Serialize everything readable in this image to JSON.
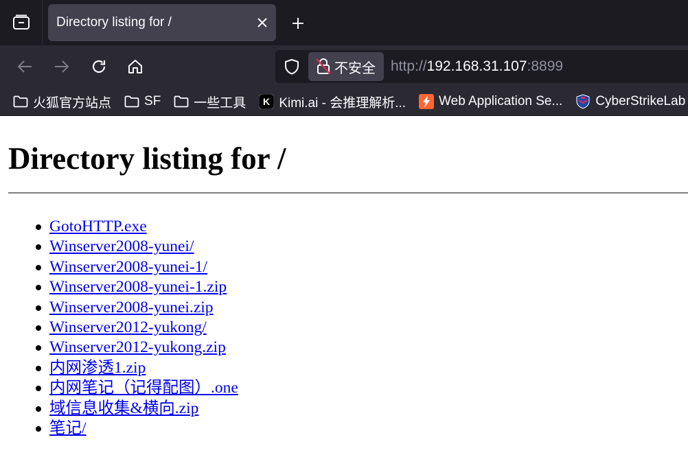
{
  "browser": {
    "tab": {
      "title": "Directory listing for /"
    },
    "urlbar": {
      "security_label": "不安全",
      "url_scheme": "http://",
      "url_host": "192.168.31.107",
      "url_port": ":8899"
    },
    "icons": {
      "tab_overview": "tab-overview-icon",
      "close": "close-icon",
      "new_tab": "plus-icon",
      "back": "arrow-left-icon",
      "forward": "arrow-right-icon",
      "reload": "reload-icon",
      "home": "home-icon",
      "shield": "shield-icon",
      "insecure_lock": "insecure-lock-icon"
    },
    "bookmarks": [
      {
        "label": "火狐官方站点",
        "icon": "folder-icon"
      },
      {
        "label": "SF",
        "icon": "folder-icon"
      },
      {
        "label": "一些工具",
        "icon": "folder-icon"
      },
      {
        "label": "Kimi.ai - 会推理解析...",
        "icon": "kimi-logo-icon"
      },
      {
        "label": "Web Application Se...",
        "icon": "bolt-icon"
      },
      {
        "label": "CyberStrikeLab",
        "icon": "badge-icon"
      }
    ],
    "colors": {
      "tabstrip": "#1c1b22",
      "toolbar": "#2b2a33",
      "active_tab": "#42414d",
      "text": "#fbfbfe",
      "muted_text": "#8f8f9d",
      "link": "#0000ee"
    }
  },
  "page": {
    "heading": "Directory listing for /",
    "files": [
      "GotoHTTP.exe",
      "Winserver2008-yunei/",
      "Winserver2008-yunei-1/",
      "Winserver2008-yunei-1.zip",
      "Winserver2008-yunei.zip",
      "Winserver2012-yukong/",
      "Winserver2012-yukong.zip",
      "内网渗透1.zip",
      "内网笔记（记得配图）.one",
      "域信息收集&横向.zip",
      "笔记/"
    ]
  }
}
